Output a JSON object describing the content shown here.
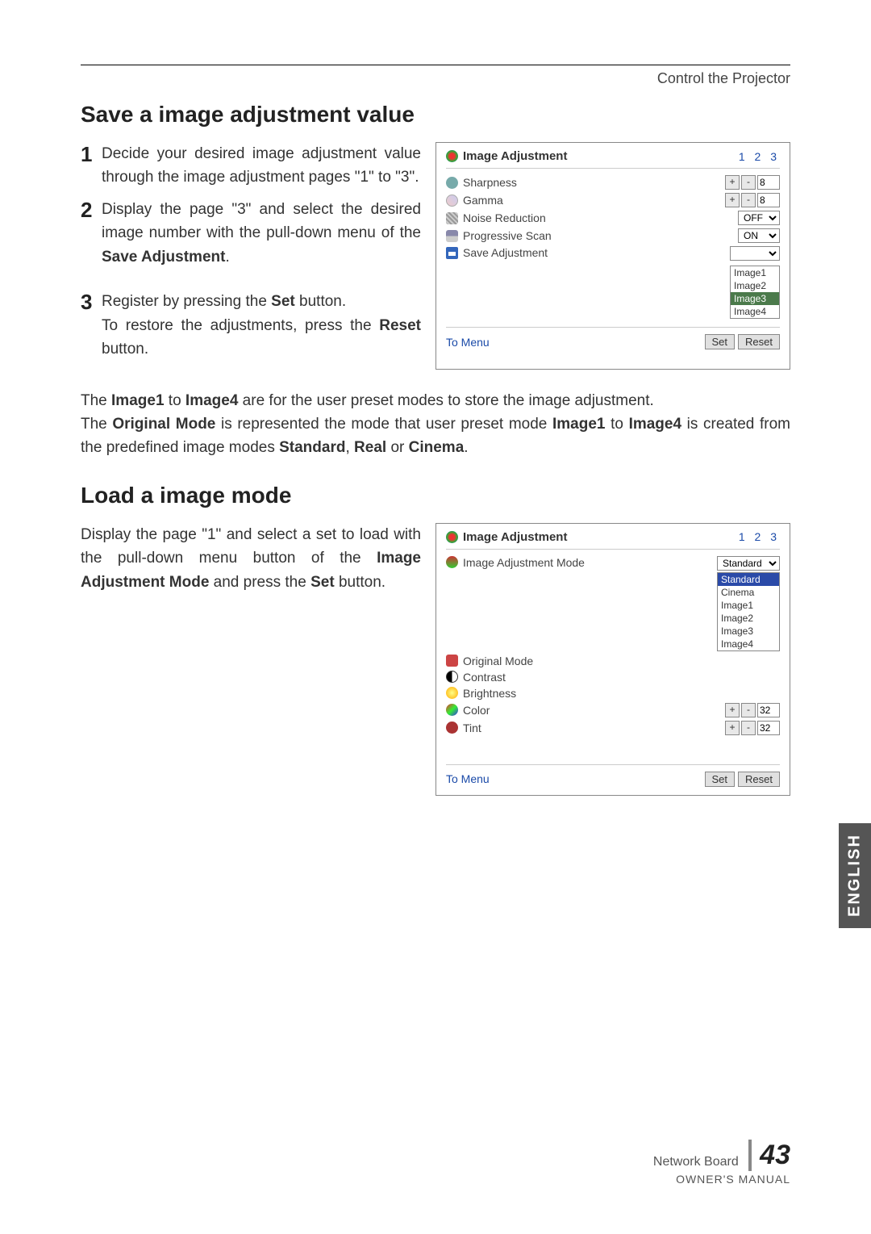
{
  "header": {
    "breadcrumb": "Control the Projector"
  },
  "section1": {
    "title": "Save a image adjustment value",
    "steps": {
      "s1": {
        "num": "1",
        "text": "Decide your desired image adjustment value through the image adjustment pages \"1\" to \"3\"."
      },
      "s2": {
        "num": "2",
        "text_before": "Display the page \"3\" and select the desired image number with the pull-down menu of the ",
        "bold": "Save Adjustment",
        "after": "."
      },
      "s3": {
        "num": "3",
        "line1_before": "Register by pressing the ",
        "line1_bold": "Set",
        "line1_after": " button.",
        "line2_before": "To restore the adjustments, press the ",
        "line2_bold": "Reset",
        "line2_after": " button."
      }
    }
  },
  "panel1": {
    "title": "Image Adjustment",
    "pages": "1  2  3",
    "rows": {
      "sharpness": {
        "label": "Sharpness",
        "value": "8"
      },
      "gamma": {
        "label": "Gamma",
        "value": "8"
      },
      "noise": {
        "label": "Noise Reduction",
        "value": "OFF"
      },
      "prog": {
        "label": "Progressive Scan",
        "value": "ON"
      },
      "save": {
        "label": "Save Adjustment",
        "options": [
          "Image1",
          "Image2",
          "Image3",
          "Image4"
        ],
        "selected": "Image3"
      }
    },
    "to_menu": "To Menu",
    "set": "Set",
    "reset": "Reset",
    "plus": "+",
    "minus": "-"
  },
  "mid_para": {
    "t1a": "The ",
    "t1b": "Image1",
    "t1c": " to ",
    "t1d": "Image4",
    "t1e": " are for the user preset modes to store the image adjustment.",
    "t2a": "The ",
    "t2b": "Original Mode",
    "t2c": " is represented the mode that user preset mode ",
    "t2d": "Image1",
    "t2e": " to ",
    "t3a": "Image4",
    "t3b": " is created from the predefined image modes ",
    "t3c": "Standard",
    "t3d": ", ",
    "t3e": "Real",
    "t3f": " or ",
    "t3g": "Cinema",
    "t3h": "."
  },
  "section2": {
    "title": "Load a image mode",
    "body_a": "Display the page \"1\" and select a set to load with the pull-down menu button of the ",
    "body_b": "Image Adjustment Mode",
    "body_c": " and press the ",
    "body_d": "Set",
    "body_e": " button."
  },
  "panel2": {
    "title": "Image Adjustment",
    "pages": "1  2  3",
    "rows": {
      "mode": {
        "label": "Image Adjustment Mode",
        "value": "Standard",
        "options": [
          "Standard",
          "Cinema",
          "Image1",
          "Image2",
          "Image3",
          "Image4"
        ],
        "selected": "Standard"
      },
      "orig": {
        "label": "Original Mode"
      },
      "contrast": {
        "label": "Contrast"
      },
      "brightness": {
        "label": "Brightness"
      },
      "color": {
        "label": "Color",
        "value": "32"
      },
      "tint": {
        "label": "Tint",
        "value": "32"
      }
    },
    "to_menu": "To Menu",
    "set": "Set",
    "reset": "Reset",
    "plus": "+",
    "minus": "-"
  },
  "side_tab": "ENGLISH",
  "footer": {
    "top": "Network Board",
    "page": "43",
    "bottom": "OWNER'S MANUAL"
  }
}
